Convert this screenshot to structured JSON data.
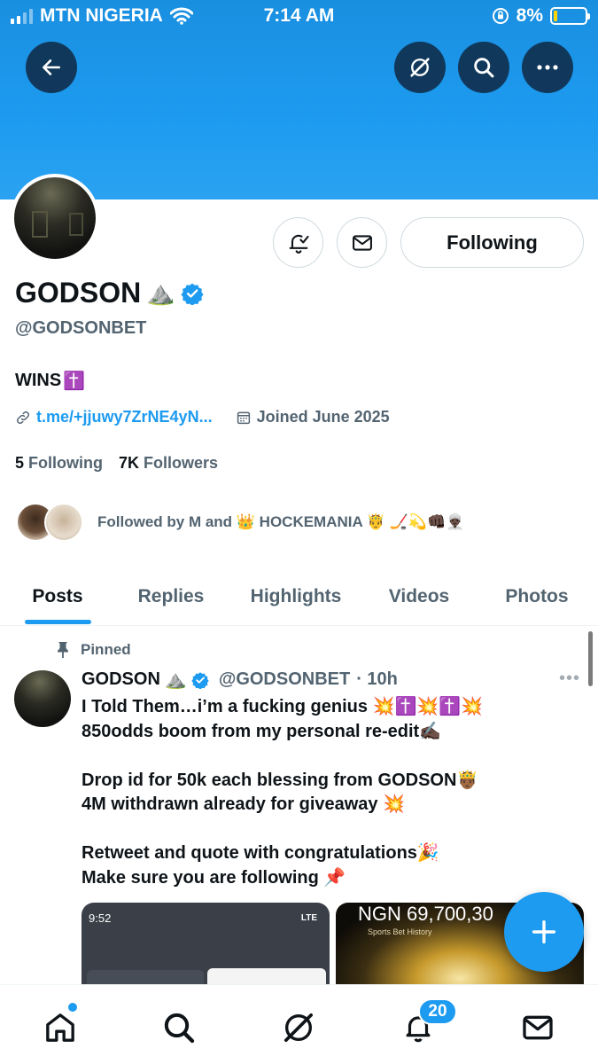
{
  "status_bar": {
    "carrier": "MTN NIGERIA",
    "time": "7:14 AM",
    "battery": "8%"
  },
  "colors": {
    "accent": "#1d9bf0",
    "text": "#0f1419",
    "muted": "#536471",
    "banner": "#1d9bf0"
  },
  "profile": {
    "name": "GODSON",
    "name_emoji": "⛰️",
    "handle": "@GODSONBET",
    "bio": "WINS",
    "bio_emoji": "✝️",
    "link": "t.me/+jjuwy7ZrNE4yN...",
    "joined": "Joined June 2025",
    "following_count": "5",
    "following_label": "Following",
    "followers_count": "7K",
    "followers_label": "Followers",
    "followed_by": "Followed by M and 👑 HOCKEMANIA 🤴 🏒💫👊🏿👳🏿‍♂️",
    "follow_button": "Following"
  },
  "tabs": [
    "Posts",
    "Replies",
    "Highlights",
    "Videos",
    "Photos"
  ],
  "active_tab": "Posts",
  "post": {
    "pinned_label": "Pinned",
    "author_name": "GODSON",
    "author_emoji": "⛰️",
    "author_handle": "@GODSONBET",
    "time": "· 10h",
    "more": "•••",
    "lines": [
      "I Told Them…i’m a fucking genius 💥✝️💥✝️💥",
      "850odds boom from my personal re-edit✍🏿",
      "",
      "Drop id for 50k each blessing from GODSON🤴🏾",
      "4M withdrawn already for giveaway 💥",
      "",
      "Retweet and quote with congratulations🎉",
      "Make sure you are following  📌"
    ],
    "media1_time": "9:52",
    "media1_status": "LTE",
    "media2_amount": "NGN 69,700,30",
    "media2_sub": "Sports Bet History"
  },
  "bottom_nav": {
    "items": [
      "home",
      "search",
      "grok",
      "notifications",
      "messages"
    ],
    "notification_badge": "20"
  },
  "icons": {
    "back": "back-arrow-icon",
    "grok": "grok-icon",
    "search": "search-icon",
    "more": "more-icon",
    "notify": "bell-check-icon",
    "message": "mail-icon",
    "link": "link-icon",
    "calendar": "calendar-icon",
    "pin": "pin-icon",
    "compose": "plus-icon"
  }
}
